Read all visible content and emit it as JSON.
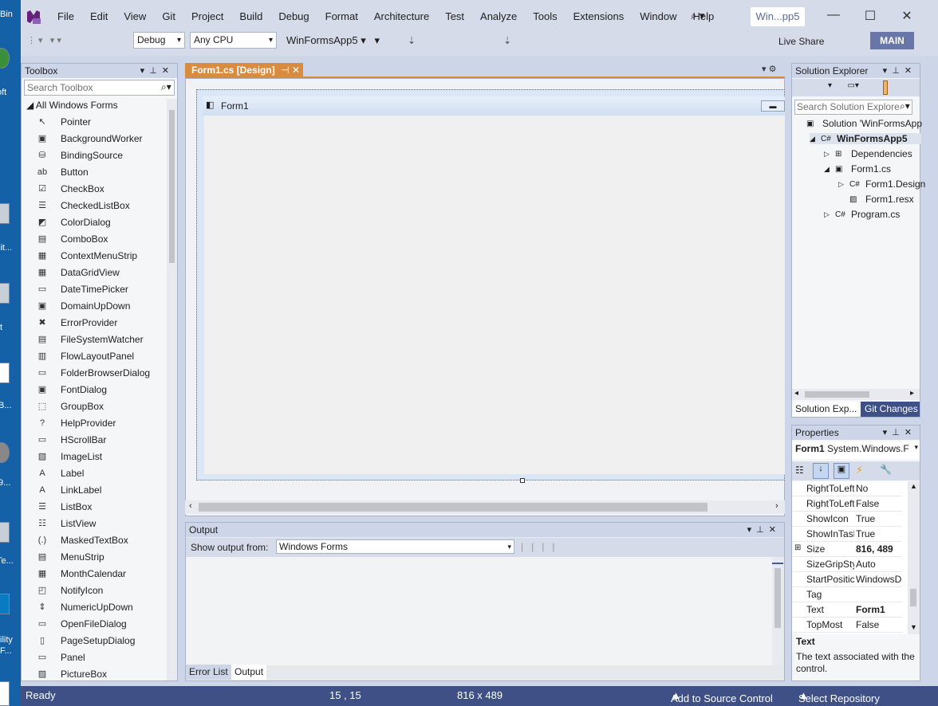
{
  "desktop": {
    "labels": [
      "Bin",
      "oft",
      "lit...",
      "t",
      "B...",
      "9...",
      "Te...",
      "ility",
      "F..."
    ]
  },
  "menu": [
    "File",
    "Edit",
    "View",
    "Git",
    "Project",
    "Build",
    "Debug",
    "Format",
    "Architecture",
    "Test",
    "Analyze",
    "Tools",
    "Extensions",
    "Window",
    "Help"
  ],
  "window": {
    "title": "Win...pp5",
    "minimize": "—",
    "maximize": "☐",
    "close": "✕"
  },
  "toolbar": {
    "config": "Debug",
    "platform": "Any CPU",
    "startup": "WinFormsApp5",
    "live_share": "Live Share",
    "badge": "MAIN"
  },
  "toolbox": {
    "title": "Toolbox",
    "search_placeholder": "Search Toolbox",
    "group": "All Windows Forms",
    "items": [
      {
        "label": "Pointer",
        "icon": "↖"
      },
      {
        "label": "BackgroundWorker",
        "icon": "▣"
      },
      {
        "label": "BindingSource",
        "icon": "⛁"
      },
      {
        "label": "Button",
        "icon": "ab"
      },
      {
        "label": "CheckBox",
        "icon": "☑"
      },
      {
        "label": "CheckedListBox",
        "icon": "☰"
      },
      {
        "label": "ColorDialog",
        "icon": "◩"
      },
      {
        "label": "ComboBox",
        "icon": "▤"
      },
      {
        "label": "ContextMenuStrip",
        "icon": "▦"
      },
      {
        "label": "DataGridView",
        "icon": "▦"
      },
      {
        "label": "DateTimePicker",
        "icon": "▭"
      },
      {
        "label": "DomainUpDown",
        "icon": "▣"
      },
      {
        "label": "ErrorProvider",
        "icon": "✖"
      },
      {
        "label": "FileSystemWatcher",
        "icon": "▤"
      },
      {
        "label": "FlowLayoutPanel",
        "icon": "▥"
      },
      {
        "label": "FolderBrowserDialog",
        "icon": "▭"
      },
      {
        "label": "FontDialog",
        "icon": "▣"
      },
      {
        "label": "GroupBox",
        "icon": "⬚"
      },
      {
        "label": "HelpProvider",
        "icon": "?"
      },
      {
        "label": "HScrollBar",
        "icon": "▭"
      },
      {
        "label": "ImageList",
        "icon": "▧"
      },
      {
        "label": "Label",
        "icon": "A"
      },
      {
        "label": "LinkLabel",
        "icon": "A"
      },
      {
        "label": "ListBox",
        "icon": "☰"
      },
      {
        "label": "ListView",
        "icon": "☷"
      },
      {
        "label": "MaskedTextBox",
        "icon": "(.)"
      },
      {
        "label": "MenuStrip",
        "icon": "▤"
      },
      {
        "label": "MonthCalendar",
        "icon": "▦"
      },
      {
        "label": "NotifyIcon",
        "icon": "◰"
      },
      {
        "label": "NumericUpDown",
        "icon": "⇕"
      },
      {
        "label": "OpenFileDialog",
        "icon": "▭"
      },
      {
        "label": "PageSetupDialog",
        "icon": "▯"
      },
      {
        "label": "Panel",
        "icon": "▭"
      },
      {
        "label": "PictureBox",
        "icon": "▨"
      }
    ]
  },
  "editor": {
    "tab": "Form1.cs [Design]",
    "form_title": "Form1"
  },
  "output": {
    "title": "Output",
    "show_from": "Show output from:",
    "source": "Windows Forms"
  },
  "bottom_tabs": [
    "Error List",
    "Output"
  ],
  "solution": {
    "title": "Solution Explorer",
    "search_placeholder": "Search Solution Explore",
    "items": [
      {
        "label": "Solution 'WinFormsApp",
        "icon": "▣",
        "indent": 0,
        "expander": ""
      },
      {
        "label": "WinFormsApp5",
        "icon": "C#",
        "indent": 1,
        "expander": "◢",
        "bold": true
      },
      {
        "label": "Dependencies",
        "icon": "⊞",
        "indent": 2,
        "expander": "▷"
      },
      {
        "label": "Form1.cs",
        "icon": "▣",
        "indent": 2,
        "expander": "◢"
      },
      {
        "label": "Form1.Design",
        "icon": "C#",
        "indent": 3,
        "expander": "▷"
      },
      {
        "label": "Form1.resx",
        "icon": "▨",
        "indent": 3,
        "expander": ""
      },
      {
        "label": "Program.cs",
        "icon": "C#",
        "indent": 2,
        "expander": "▷"
      }
    ],
    "tabs": [
      "Solution Exp...",
      "Git Changes"
    ]
  },
  "properties": {
    "title": "Properties",
    "object": "Form1",
    "object_type": "System.Windows.F",
    "rows": [
      {
        "name": "RightToLeft",
        "value": "No",
        "bold": false
      },
      {
        "name": "RightToLeft",
        "value": "False",
        "bold": false
      },
      {
        "name": "ShowIcon",
        "value": "True",
        "bold": false
      },
      {
        "name": "ShowInTask",
        "value": "True",
        "bold": false
      },
      {
        "name": "Size",
        "value": "816, 489",
        "bold": true
      },
      {
        "name": "SizeGripSty",
        "value": "Auto",
        "bold": false
      },
      {
        "name": "StartPositic",
        "value": "WindowsDe",
        "bold": false
      },
      {
        "name": "Tag",
        "value": "",
        "bold": false
      },
      {
        "name": "Text",
        "value": "Form1",
        "bold": true
      },
      {
        "name": "TopMost",
        "value": "False",
        "bold": false
      }
    ],
    "desc_title": "Text",
    "desc_text": "The text associated with the control."
  },
  "status": {
    "ready": "Ready",
    "position": "15 , 15",
    "size": "816 x 489",
    "source_control": "Add to Source Control",
    "repository": "Select Repository"
  }
}
